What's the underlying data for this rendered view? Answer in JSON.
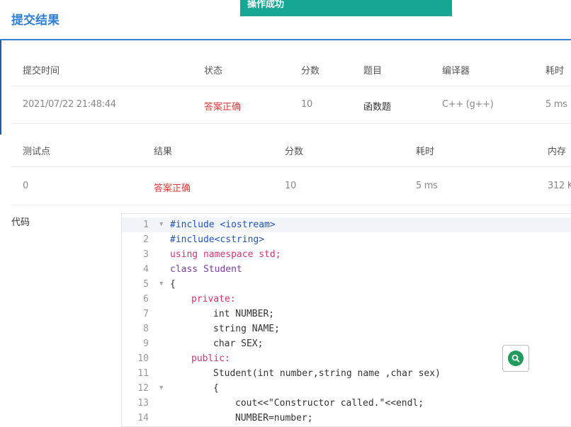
{
  "page": {
    "title": "提交结果",
    "toast": "操作成功"
  },
  "submission": {
    "headers": [
      "提交时间",
      "状态",
      "分数",
      "题目",
      "编译器",
      "耗时"
    ],
    "row": {
      "time": "2021/07/22 21:48:44",
      "status": "答案正确",
      "score": "10",
      "problem": "函数题",
      "compiler": "C++ (g++)",
      "elapsed": "5 ms"
    }
  },
  "tests": {
    "headers": [
      "测试点",
      "结果",
      "分数",
      "耗时",
      "内存"
    ],
    "row": {
      "point": "0",
      "result": "答案正确",
      "score": "10",
      "elapsed": "5 ms",
      "memory": "312 K"
    }
  },
  "code": {
    "label": "代码",
    "lines": [
      {
        "n": "1",
        "text": "#include <iostream>"
      },
      {
        "n": "2",
        "text": "#include<cstring>"
      },
      {
        "n": "3",
        "text": "using namespace std;"
      },
      {
        "n": "4",
        "text": "class Student"
      },
      {
        "n": "5",
        "text": "{"
      },
      {
        "n": "6",
        "text": "private:"
      },
      {
        "n": "7",
        "text": "int NUMBER;"
      },
      {
        "n": "8",
        "text": "string NAME;"
      },
      {
        "n": "9",
        "text": "char SEX;"
      },
      {
        "n": "10",
        "text": "public:"
      },
      {
        "n": "11",
        "text": "Student(int number,string name ,char sex)"
      },
      {
        "n": "12",
        "text": "{"
      },
      {
        "n": "13",
        "text": "cout<<\"Constructor called.\"<<endl;"
      },
      {
        "n": "14",
        "text": "NUMBER=number;"
      }
    ]
  },
  "icons": {
    "search": "search-icon"
  },
  "colors": {
    "accent": "#2f7fd2",
    "toast": "#17a594",
    "ok": "#e03a3a",
    "search": "#1f9b5b"
  }
}
